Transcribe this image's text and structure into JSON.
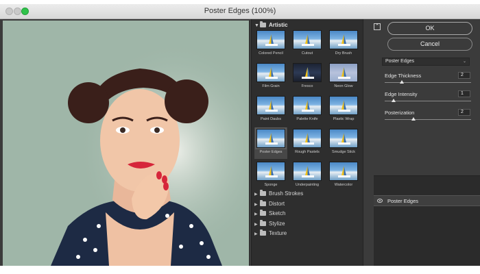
{
  "window": {
    "title": "Poster Edges (100%)"
  },
  "gallery": {
    "category": "Artistic",
    "filters": [
      {
        "label": "Colored Pencil",
        "style": "normal"
      },
      {
        "label": "Cutout",
        "style": "normal"
      },
      {
        "label": "Dry Brush",
        "style": "normal"
      },
      {
        "label": "Film Grain",
        "style": "normal"
      },
      {
        "label": "Fresco",
        "style": "dark"
      },
      {
        "label": "Neon Glow",
        "style": "pale"
      },
      {
        "label": "Paint Daubs",
        "style": "normal"
      },
      {
        "label": "Palette Knife",
        "style": "normal"
      },
      {
        "label": "Plastic Wrap",
        "style": "normal"
      },
      {
        "label": "Poster Edges",
        "style": "normal",
        "selected": true
      },
      {
        "label": "Rough Pastels",
        "style": "normal"
      },
      {
        "label": "Smudge Stick",
        "style": "normal"
      },
      {
        "label": "Sponge",
        "style": "normal"
      },
      {
        "label": "Underpainting",
        "style": "normal"
      },
      {
        "label": "Watercolor",
        "style": "normal"
      }
    ],
    "subcategories": [
      "Brush Strokes",
      "Distort",
      "Sketch",
      "Stylize",
      "Texture"
    ]
  },
  "controls": {
    "ok_label": "OK",
    "cancel_label": "Cancel",
    "collapse_symbol": "⌃",
    "filter_select": "Poster Edges",
    "params": [
      {
        "label": "Edge Thickness",
        "value": "2",
        "level": 0.2
      },
      {
        "label": "Edge Intensity",
        "value": "1",
        "level": 0.1
      },
      {
        "label": "Posterization",
        "value": "2",
        "level": 0.33
      }
    ]
  },
  "effects": {
    "layer_name": "Poster Edges"
  },
  "colors": {
    "panel_bg": "#3b3b3b",
    "gallery_bg": "#2e2e2e",
    "preview_bg": "#9fb6a8",
    "zoom_green": "#2fc24a"
  }
}
